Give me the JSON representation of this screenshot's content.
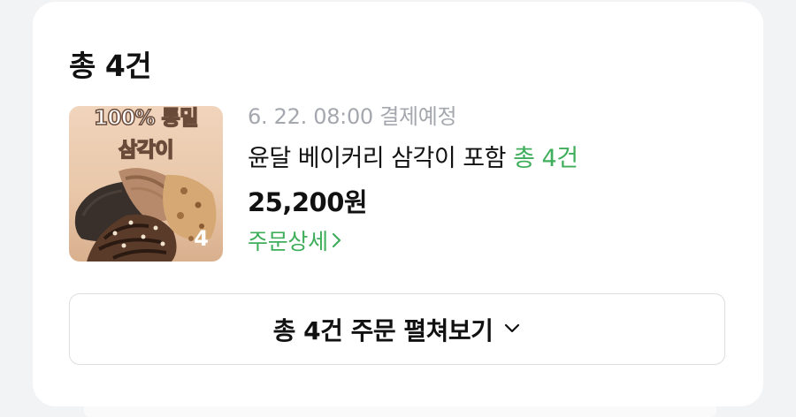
{
  "summary": {
    "title": "총 4건"
  },
  "order": {
    "thumbnail": {
      "overlay_line1": "100% 통밀",
      "overlay_line2": "삼각이",
      "count_badge": "4"
    },
    "schedule_text": "6. 22. 08:00 결제예정",
    "product_name": "윤달 베이커리 삼각이 포함",
    "product_count": "총 4건",
    "price": "25,200원",
    "detail_link_label": "주문상세"
  },
  "expand_button": {
    "label": "총 4건 주문 펼쳐보기"
  },
  "colors": {
    "accent_green": "#3fae5b",
    "text_primary": "#111111",
    "text_muted": "#a4a7ad",
    "background": "#f2f3f5",
    "card": "#ffffff",
    "border": "#dcdee2"
  },
  "icons": {
    "detail_chevron": "chevron-right-icon",
    "expand_chevron": "chevron-down-icon"
  }
}
